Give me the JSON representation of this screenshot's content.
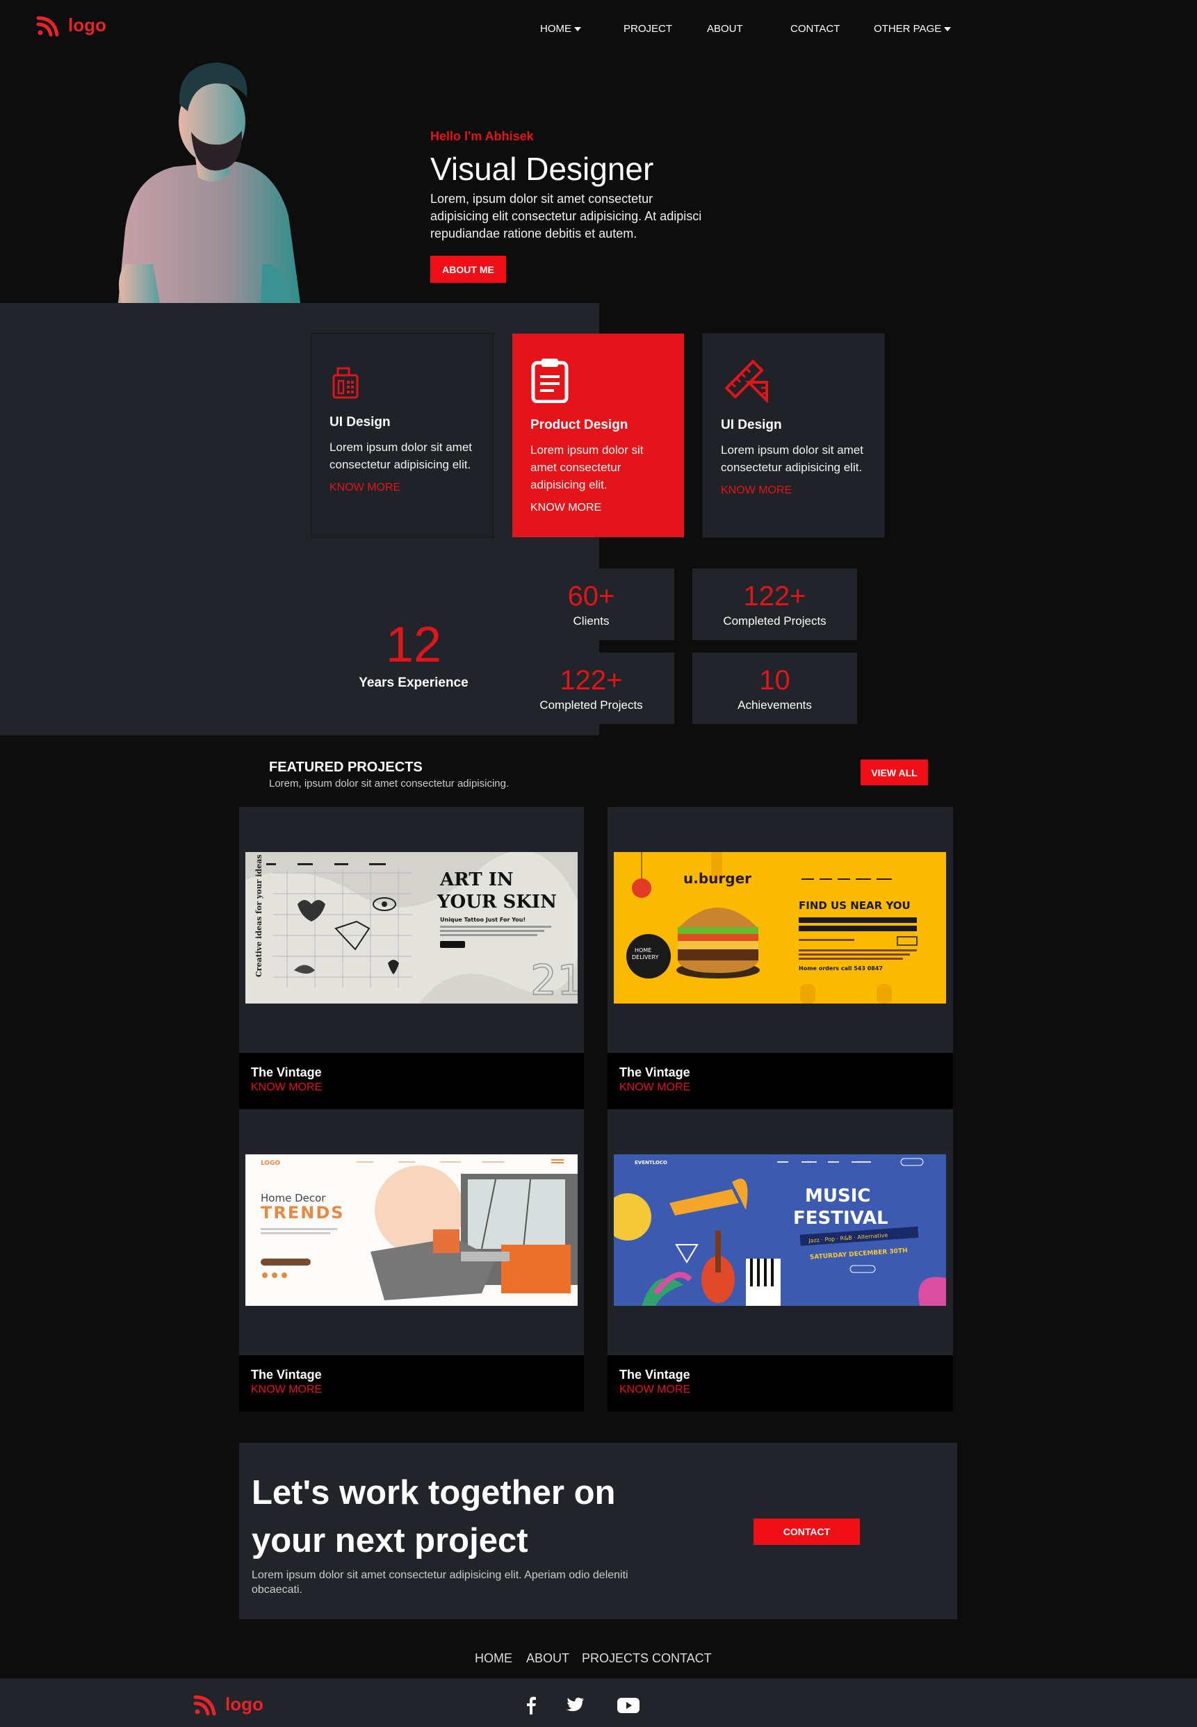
{
  "header": {
    "logo_text": "logo",
    "nav": [
      {
        "label": "HOME",
        "has_caret": true
      },
      {
        "label": "PROJECT"
      },
      {
        "label": "ABOUT"
      },
      {
        "label": "CONTACT"
      },
      {
        "label": "OTHER PAGE",
        "has_caret": true
      }
    ]
  },
  "hero": {
    "greeting": "Hello I'm Abhisek",
    "title": "Visual Designer",
    "text": "Lorem, ipsum dolor sit amet consectetur adipisicing elit consectetur adipisicing. At adipisci repudiandae ratione debitis et autem.",
    "button": "ABOUT ME"
  },
  "services": [
    {
      "icon": "fax-machine-icon",
      "title": "UI Design",
      "text": "Lorem ipsum dolor sit amet consectetur adipisicing elit.",
      "link": "KNOW MORE"
    },
    {
      "icon": "clipboard-icon",
      "title": "Product Design",
      "text": "Lorem ipsum dolor sit amet consectetur adipisicing elit.",
      "link": "KNOW MORE"
    },
    {
      "icon": "ruler-pencil-icon",
      "title": "UI Design",
      "text": "Lorem ipsum dolor sit amet consectetur adipisicing elit.",
      "link": "KNOW MORE"
    }
  ],
  "experience": {
    "value": "12",
    "label": "Years Experience"
  },
  "stats": [
    {
      "value": "60+",
      "label": "Clients"
    },
    {
      "value": "122+",
      "label": "Completed Projects"
    },
    {
      "value": "122+",
      "label": "Completed Projects"
    },
    {
      "value": "10",
      "label": "Achievements"
    }
  ],
  "featured": {
    "title": "FEATURED PROJECTS",
    "subtitle": "Lorem, ipsum dolor sit amet consectetur adipisicing.",
    "button": "VIEW ALL",
    "projects": [
      {
        "title": "The Vintage",
        "link": "KNOW MORE",
        "thumb_text": "ART IN YOUR SKIN",
        "thumb_sub": "Unique Tattoo Just For You!",
        "thumb_side": "Creative ideas for your ideas"
      },
      {
        "title": "The Vintage",
        "link": "KNOW MORE",
        "thumb_text": "FIND US NEAR YOU",
        "thumb_brand": "u.burger",
        "thumb_sub": "Home orders call 543 0847"
      },
      {
        "title": "The Vintage",
        "link": "KNOW MORE",
        "thumb_text": "TRENDS",
        "thumb_brand": "Home Decor",
        "thumb_logo": "LOGO"
      },
      {
        "title": "The Vintage",
        "link": "KNOW MORE",
        "thumb_text": "MUSIC FESTIVAL",
        "thumb_sub": "SATURDAY DECEMBER 30TH",
        "thumb_tags": "Jazz · Pop · R&B · Alternative",
        "thumb_brand": "EVENTLOCO"
      }
    ]
  },
  "cta": {
    "title_line1": "Let's work together on",
    "title_line2": "your next project",
    "text": "Lorem ipsum dolor sit amet consectetur adipisicing elit. Aperiam odio deleniti obcaecati.",
    "button": "CONTACT"
  },
  "footer": {
    "nav": [
      "HOME",
      "ABOUT",
      "PROJECTS",
      "CONTACT"
    ],
    "logo_text": "logo",
    "social": [
      "facebook-icon",
      "twitter-icon",
      "youtube-icon"
    ]
  },
  "colors": {
    "accent": "#e0141b",
    "bg": "#0d0d0e",
    "panel": "#212428"
  }
}
